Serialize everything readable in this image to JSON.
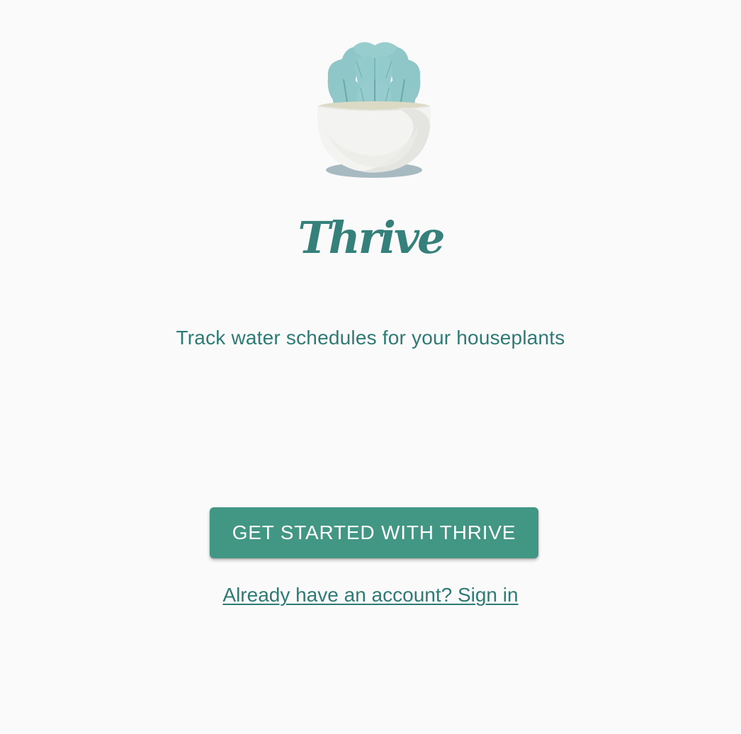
{
  "app": {
    "title": "Thrive",
    "tagline": "Track water schedules for your houseplants"
  },
  "actions": {
    "primary_label": "GET STARTED WITH THRIVE",
    "signin_label": "Already have an account? Sign in"
  },
  "icons": {
    "logo": "succulent-pot-icon"
  },
  "colors": {
    "background": "#fafafa",
    "brand": "#35807b",
    "button": "#429684",
    "button_text": "#ffffff",
    "leaf": "#8fc7c8",
    "leaf_shadow": "#6aa9a8",
    "pot": "#f3f3f1",
    "pot_shade": "#e2e3df",
    "pot_shadow": "#a7b9c1"
  }
}
